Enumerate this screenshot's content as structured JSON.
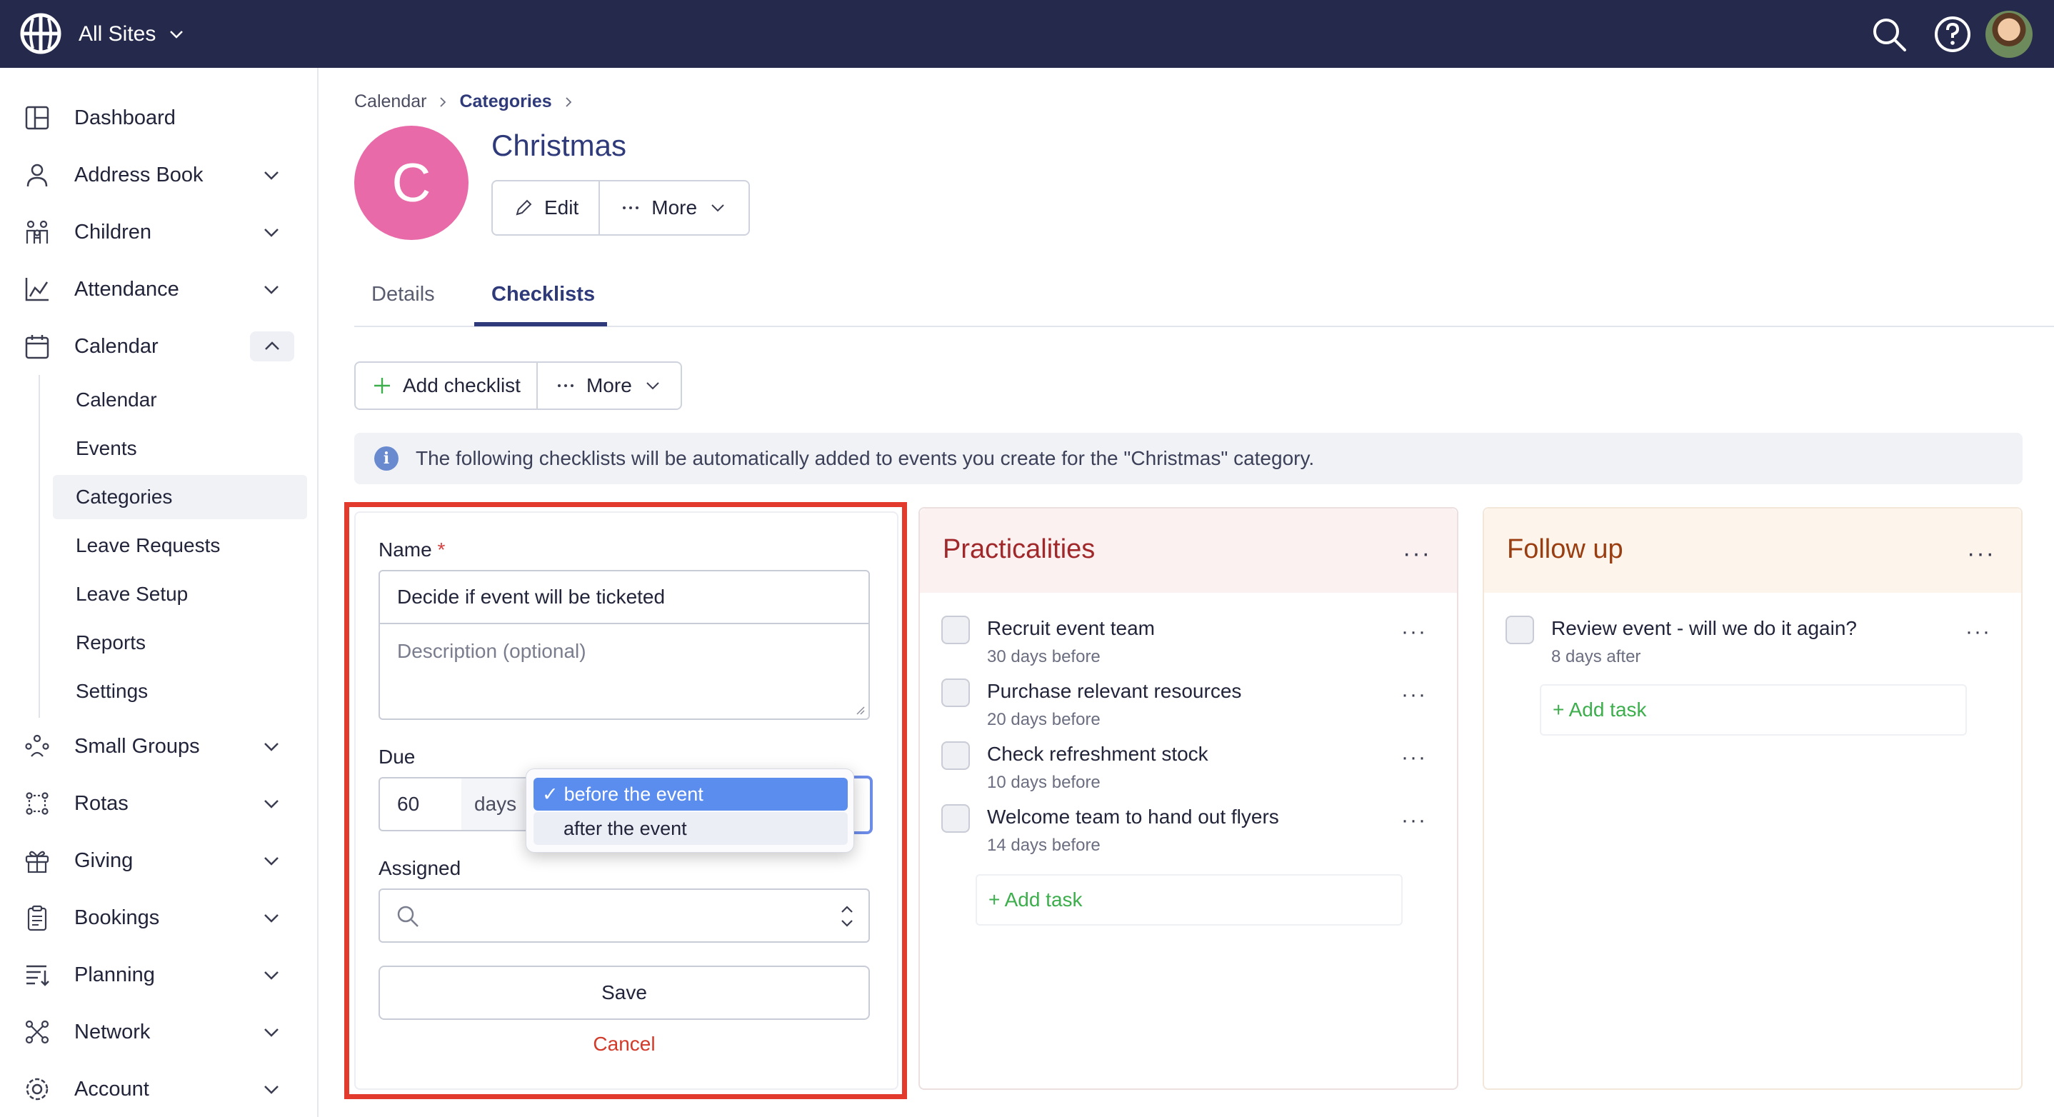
{
  "topbar": {
    "site_label": "All Sites",
    "icons": [
      "globe-logo-icon",
      "search-icon",
      "help-icon",
      "avatar"
    ]
  },
  "sidebar": {
    "items": [
      {
        "label": "Dashboard",
        "icon": "dashboard-icon"
      },
      {
        "label": "Address Book",
        "icon": "person-icon"
      },
      {
        "label": "Children",
        "icon": "children-icon"
      },
      {
        "label": "Attendance",
        "icon": "chart-icon"
      },
      {
        "label": "Calendar",
        "icon": "calendar-icon"
      },
      {
        "label": "Small Groups",
        "icon": "groups-icon"
      },
      {
        "label": "Rotas",
        "icon": "rotas-icon"
      },
      {
        "label": "Giving",
        "icon": "gift-icon"
      },
      {
        "label": "Bookings",
        "icon": "clipboard-icon"
      },
      {
        "label": "Planning",
        "icon": "planning-icon"
      },
      {
        "label": "Network",
        "icon": "network-icon"
      },
      {
        "label": "Account",
        "icon": "gear-icon"
      }
    ],
    "calendar_sub": [
      "Calendar",
      "Events",
      "Categories",
      "Leave Requests",
      "Leave Setup",
      "Reports",
      "Settings"
    ],
    "active_sub": "Categories"
  },
  "breadcrumb": {
    "items": [
      "Calendar",
      "Categories"
    ]
  },
  "category": {
    "initial": "C",
    "title": "Christmas",
    "avatar_color": "#e86aa8",
    "edit_label": "Edit",
    "more_label": "More"
  },
  "tabs": [
    {
      "label": "Details"
    },
    {
      "label": "Checklists"
    }
  ],
  "active_tab": "Checklists",
  "toolbar": {
    "add_label": "Add checklist",
    "more_label": "More"
  },
  "info": {
    "text": "The following checklists will be automatically added to events you create for the \"Christmas\" category."
  },
  "form": {
    "name_label": "Name",
    "required_mark": "*",
    "name_value": "Decide if event will be ticketed",
    "description_placeholder": "Description (optional)",
    "due_label": "Due",
    "due_value": "60",
    "due_unit": "days",
    "due_options": [
      "before the event",
      "after the event"
    ],
    "due_selected": "before the event",
    "assigned_label": "Assigned",
    "save_label": "Save",
    "cancel_label": "Cancel"
  },
  "checklists": [
    {
      "title": "Practicalities",
      "title_color": "#a0282a",
      "header_bg": "#fcf1f1",
      "tasks": [
        {
          "name": "Recruit event team",
          "due": "30 days before"
        },
        {
          "name": "Purchase relevant resources",
          "due": "20 days before"
        },
        {
          "name": "Check refreshment stock",
          "due": "10 days before"
        },
        {
          "name": "Welcome team to hand out flyers",
          "due": "14 days before"
        }
      ],
      "add_label": "+ Add task"
    },
    {
      "title": "Follow up",
      "title_color": "#9a3d10",
      "header_bg": "#fdf5ec",
      "tasks": [
        {
          "name": "Review event - will we do it again?",
          "due": "8 days after"
        }
      ],
      "add_label": "+ Add task"
    }
  ],
  "colors": {
    "nav_bg": "#252a4d",
    "accent": "#2f3a7a",
    "highlight": "#e23b2e",
    "add_green": "#3cae4c",
    "cancel_red": "#d23a2a"
  }
}
